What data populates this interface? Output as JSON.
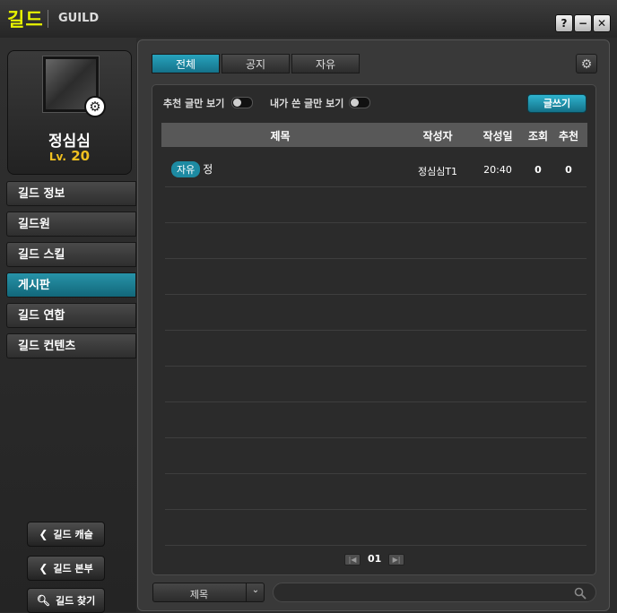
{
  "window": {
    "title_kr": "길드",
    "title_en": "GUILD",
    "help_label": "?",
    "minimize_label": "−",
    "close_label": "✕"
  },
  "profile": {
    "name": "정심심",
    "level_prefix": "Lv.",
    "level": "20"
  },
  "sidebar": {
    "items": [
      {
        "label": "길드 정보"
      },
      {
        "label": "길드원"
      },
      {
        "label": "길드 스킬"
      },
      {
        "label": "게시판"
      },
      {
        "label": "길드 연합"
      },
      {
        "label": "길드 컨텐츠"
      }
    ],
    "active_index": 3,
    "buttons": {
      "castle": "길드 캐슬",
      "hq": "길드 본부",
      "find": "길드 찾기"
    }
  },
  "tabs": [
    {
      "label": "전체",
      "active": true
    },
    {
      "label": "공지",
      "active": false
    },
    {
      "label": "자유",
      "active": false
    }
  ],
  "filters": {
    "recommended_only": "추천 글만 보기",
    "my_posts_only": "내가 쓴 글만 보기"
  },
  "write_button": "글쓰기",
  "table": {
    "columns": {
      "title": "제목",
      "author": "작성자",
      "date": "작성일",
      "views": "조회",
      "likes": "추천"
    },
    "rows": [
      {
        "category": "자유",
        "title": "정",
        "author": "정심심T1",
        "date": "20:40",
        "views": "0",
        "likes": "0"
      }
    ]
  },
  "pagination": {
    "current": "01"
  },
  "search": {
    "category": "제목",
    "query": ""
  },
  "colors": {
    "accent": "#1d8aa2",
    "title_yellow": "#e8f300",
    "level_gold": "#f0c020"
  }
}
